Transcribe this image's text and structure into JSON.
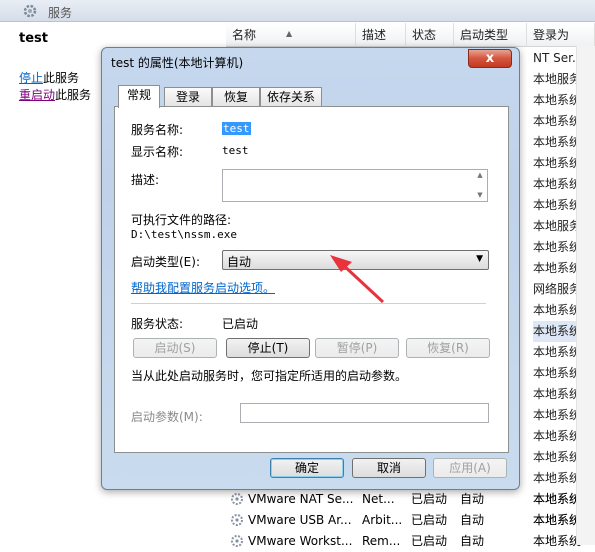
{
  "window": {
    "title": "服务"
  },
  "left_pane": {
    "service_name": "test",
    "stop_link": "停止",
    "stop_suffix": "此服务",
    "restart_link": "重启动",
    "restart_suffix": "此服务",
    "edge_chars": [
      "\u0000",
      "\u0000"
    ]
  },
  "list": {
    "columns": [
      "名称",
      "描述",
      "状态",
      "启动类型",
      "登录为"
    ],
    "logon_as": [
      "NT Ser...",
      "本地服务",
      "本地系统",
      "本地系统",
      "本地系统",
      "本地系统",
      "本地系统",
      "本地系统",
      "本地服务",
      "本地系统",
      "本地系统",
      "网络服务",
      "本地系统",
      "本地系统",
      "本地系统",
      "本地系统",
      "本地系统",
      "本地系统",
      "本地系统",
      "本地系统",
      "本地系统",
      "本地系统",
      "本地系统"
    ],
    "bottom_rows": [
      {
        "name": "VMware NAT Se...",
        "desc": "Net...",
        "status": "已启动",
        "startup": "自动",
        "logon": "本地系统"
      },
      {
        "name": "VMware USB Ar...",
        "desc": "Arbit...",
        "status": "已启动",
        "startup": "自动",
        "logon": "本地系统"
      },
      {
        "name": "VMware Workst...",
        "desc": "Rem...",
        "status": "已启动",
        "startup": "自动",
        "logon": "本地系统"
      }
    ]
  },
  "dialog": {
    "title": "test 的属性(本地计算机)",
    "close": "x",
    "tabs": [
      "常规",
      "登录",
      "恢复",
      "依存关系"
    ],
    "service_name_label": "服务名称:",
    "service_name": "test",
    "display_name_label": "显示名称:",
    "display_name": "test",
    "description_label": "描述:",
    "exe_path_label": "可执行文件的路径:",
    "exe_path": "D:\\test\\nssm.exe",
    "startup_type_label": "启动类型(E):",
    "startup_type": "自动",
    "help_link": "帮助我配置服务启动选项。",
    "status_label": "服务状态:",
    "status": "已启动",
    "buttons": {
      "start": "启动(S)",
      "stop": "停止(T)",
      "pause": "暂停(P)",
      "resume": "恢复(R)"
    },
    "hint": "当从此处启动服务时，您可指定所适用的启动参数。",
    "params_label": "启动参数(M):",
    "ok": "确定",
    "cancel": "取消",
    "apply": "应用(A)"
  },
  "colors": {
    "arrow": "#e8323c",
    "selection": "#3399ff",
    "link": "#0066cc"
  }
}
